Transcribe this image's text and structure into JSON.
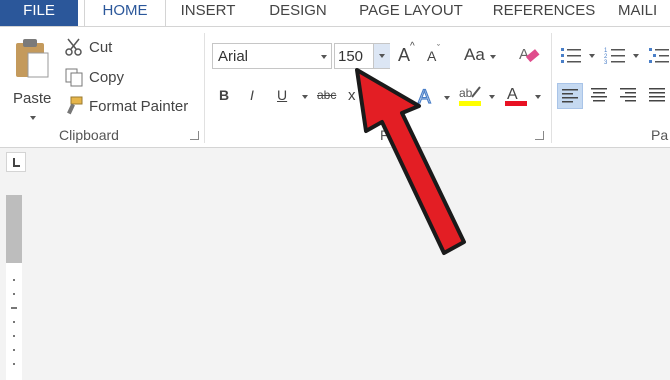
{
  "tabs": [
    "FILE",
    "HOME",
    "INSERT",
    "DESIGN",
    "PAGE LAYOUT",
    "REFERENCES",
    "MAILI"
  ],
  "clipboard": {
    "paste": "Paste",
    "cut": "Cut",
    "copy": "Copy",
    "format_painter": "Format Painter",
    "group_label": "Clipboard"
  },
  "font": {
    "name": "Arial",
    "size": "150",
    "change_case": "Aa",
    "group_label_partial": "F",
    "bold": "B",
    "italic": "I",
    "underline": "U",
    "strikethrough": "abc",
    "subscript_partial": "x"
  },
  "paragraph": {
    "group_label_partial": "Pa"
  },
  "colors": {
    "file_tab": "#2b579a",
    "highlight_color": "#ffff00",
    "font_color": "#e81123",
    "arrow": "#e31e24"
  },
  "annotation": {
    "type": "arrow",
    "points_to": "font-size-dropdown"
  }
}
